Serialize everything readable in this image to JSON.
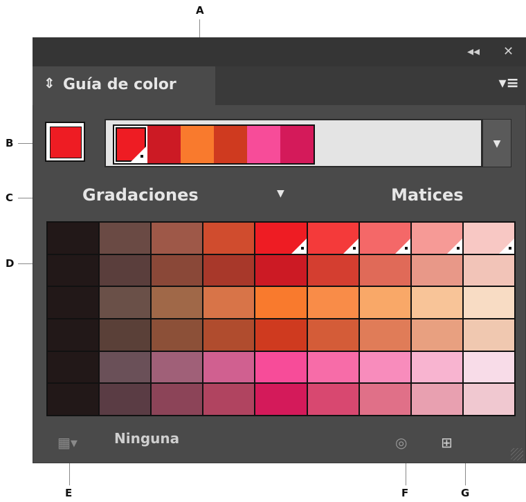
{
  "callouts": {
    "a": "A",
    "b": "B",
    "c": "C",
    "d": "D",
    "e": "E",
    "f": "F",
    "g": "G"
  },
  "panel": {
    "collapse_icon": "◂◂",
    "close_icon": "✕",
    "tab_label": "Guía de color",
    "tab_arrow_icon": "⇕",
    "menu_icon": "▾≡",
    "base_color": "#ee1c23",
    "harmony_colors": [
      "#ee1c23",
      "#cc1a24",
      "#f97a2d",
      "#cf3a1f",
      "#f74c99",
      "#d41a5a"
    ],
    "harmony_dropdown_icon": "▼",
    "variation_left": "Gradaciones",
    "variation_arrow": "▼",
    "variation_right": "Matices",
    "grid_rows": [
      [
        "#221818",
        "#6a4a44",
        "#9e5848",
        "#d04c2e",
        "#ee1c23",
        "#f43a3a",
        "#f46868",
        "#f69a96",
        "#f8c8c4"
      ],
      [
        "#221818",
        "#5a3e3c",
        "#8a4838",
        "#a8382a",
        "#cc1a24",
        "#d43e30",
        "#e06a58",
        "#e89888",
        "#f2c4b8"
      ],
      [
        "#221818",
        "#6a5048",
        "#a06848",
        "#d87448",
        "#f97a2d",
        "#f98c48",
        "#f9a868",
        "#f8c498",
        "#f8dcc4"
      ],
      [
        "#221818",
        "#5a4038",
        "#8c5038",
        "#b04c2e",
        "#cf3a1f",
        "#d45c38",
        "#e07c58",
        "#e8a080",
        "#f0c8b0"
      ],
      [
        "#221818",
        "#6a5058",
        "#a06078",
        "#d06090",
        "#f74c99",
        "#f76ca8",
        "#f88cbc",
        "#f8b4d0",
        "#f8dce8"
      ],
      [
        "#221818",
        "#5a3c44",
        "#8c4458",
        "#b04460",
        "#d41a5a",
        "#d84870",
        "#e07088",
        "#e8a0b0",
        "#f0c8d0"
      ]
    ],
    "flag_row": 0,
    "flag_from_col": 4,
    "footer_grid_icon": "▦▾",
    "footer_label": "Ninguna",
    "footer_color_wheel_icon": "◎",
    "footer_save_icon": "⊞"
  }
}
